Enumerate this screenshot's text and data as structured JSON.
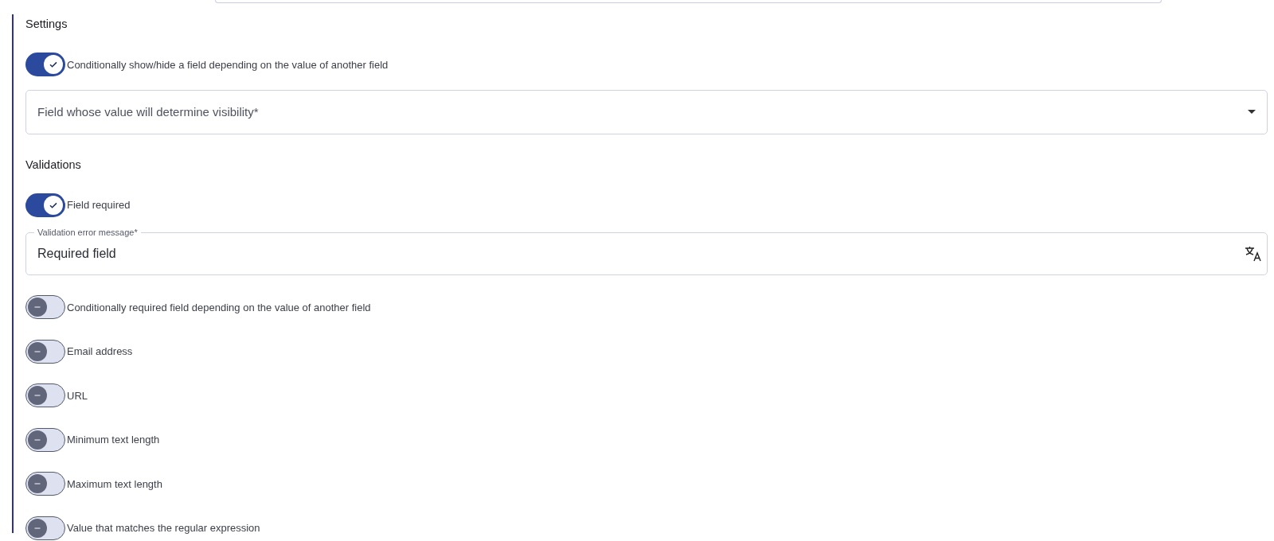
{
  "top_field": {
    "kind": "text_field"
  },
  "sections": [
    {
      "title": "Settings",
      "items": [
        {
          "kind": "toggle",
          "label": "Conditionally show/hide a field depending on the value of another field",
          "on": true
        },
        {
          "kind": "select",
          "placeholder": "Field whose value will determine visibility*"
        }
      ]
    },
    {
      "title": "Validations",
      "items": [
        {
          "kind": "toggle",
          "label": "Field required",
          "on": true
        },
        {
          "kind": "text_field",
          "legend": "Validation error message*",
          "value": "Required field"
        },
        {
          "kind": "toggle",
          "label": "Conditionally required field depending on the value of another field",
          "on": false
        },
        {
          "kind": "toggle",
          "label": "Email address",
          "on": false
        },
        {
          "kind": "toggle",
          "label": "URL",
          "on": false
        },
        {
          "kind": "toggle",
          "label": "Minimum text length",
          "on": false
        },
        {
          "kind": "toggle",
          "label": "Maximum text length",
          "on": false
        },
        {
          "kind": "toggle",
          "label": "Value that matches the regular expression",
          "on": false
        }
      ]
    }
  ]
}
